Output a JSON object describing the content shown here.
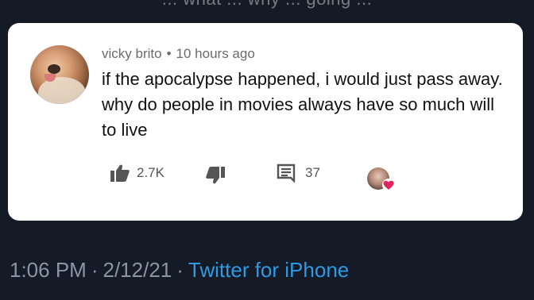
{
  "header": {
    "partial_text": "... what ... why ... going ..."
  },
  "comment": {
    "author": "vicky brito",
    "separator": "•",
    "time": "10 hours ago",
    "text": "if the apocalypse happened, i would just pass away. why do people in movies always have so much will to live",
    "likes": "2.7K",
    "replies": "37"
  },
  "tweet_footer": {
    "time": "1:06 PM",
    "dot": "·",
    "date": "2/12/21",
    "dot2": "·",
    "source": "Twitter for iPhone"
  },
  "colors": {
    "background": "#141a26",
    "card": "#ffffff",
    "link": "#2f9ae3",
    "heart": "#e0245e"
  },
  "icons": [
    "thumbs-up-icon",
    "thumbs-down-icon",
    "reply-icon",
    "creator-heart-icon"
  ]
}
